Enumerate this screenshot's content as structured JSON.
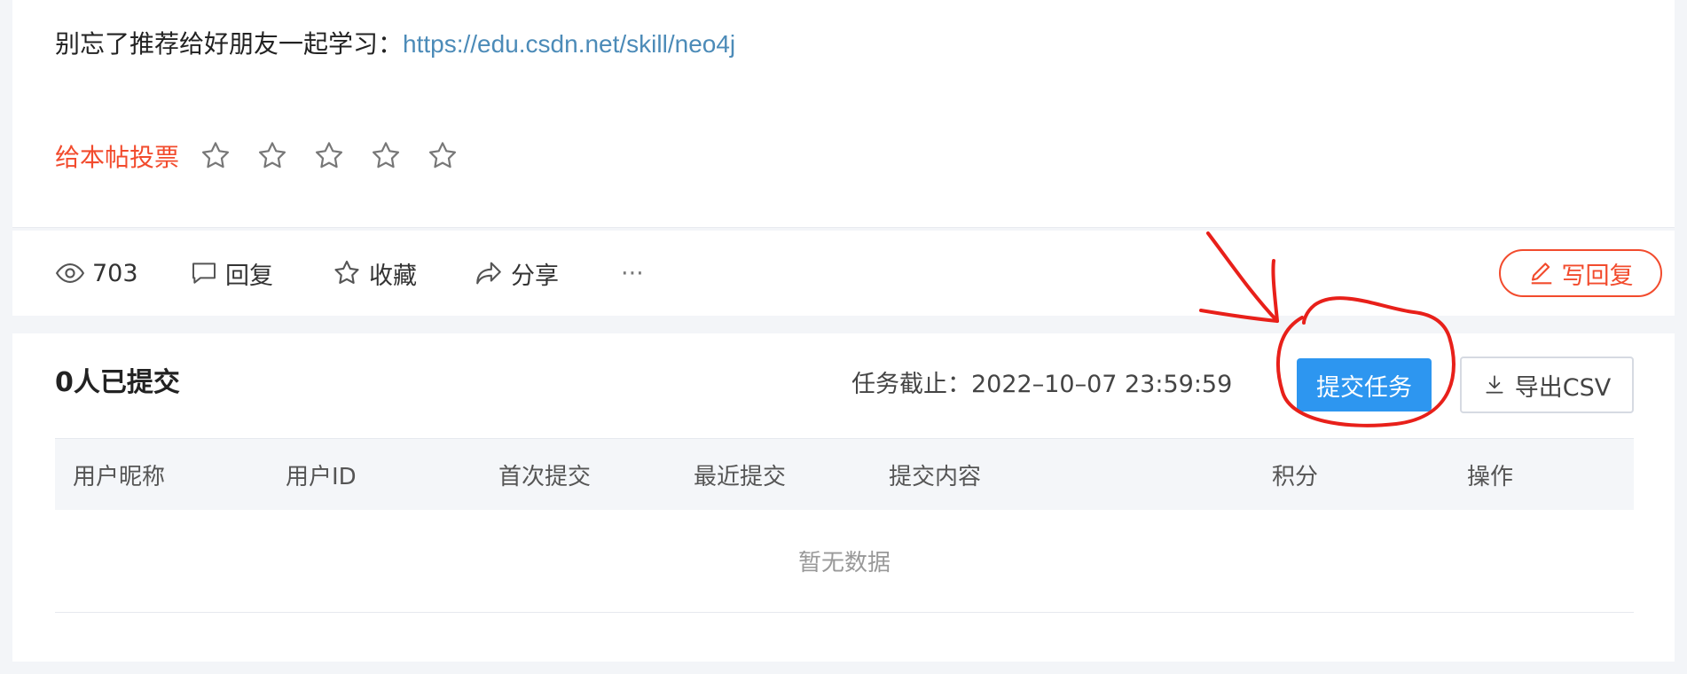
{
  "post": {
    "recommend_text": "别忘了推荐给好朋友一起学习：",
    "recommend_link": "https://edu.csdn.net/skill/neo4j",
    "vote_label": "给本帖投票",
    "star_count": 5,
    "star_icon": "star-outline-icon"
  },
  "actions": {
    "views": "703",
    "reply": "回复",
    "favorite": "收藏",
    "share": "分享",
    "more": "···",
    "write_reply": "写回复"
  },
  "task": {
    "submitted_count": "0人已提交",
    "deadline": "任务截止：2022–10–07 23:59:59",
    "submit_button": "提交任务",
    "export_button": "导出CSV",
    "columns": [
      "用户昵称",
      "用户ID",
      "首次提交",
      "最近提交",
      "提交内容",
      "积分",
      "操作"
    ],
    "empty_text": "暂无数据"
  },
  "colors": {
    "accent_red": "#f24b2d",
    "primary_blue": "#2d96f0",
    "link_blue": "#4c8bb8",
    "annotation_red": "#e8201a"
  }
}
